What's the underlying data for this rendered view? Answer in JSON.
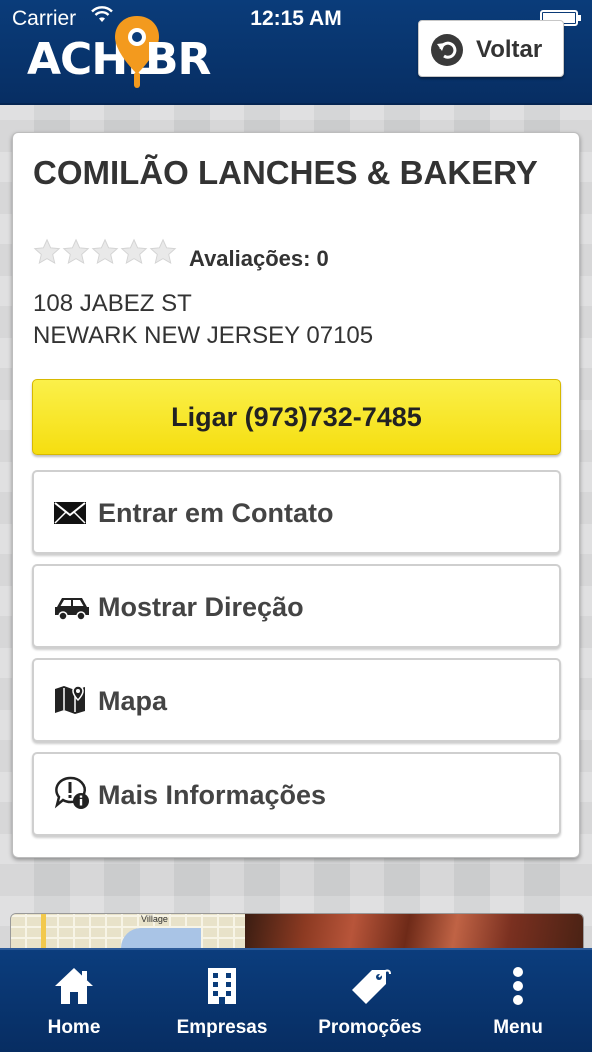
{
  "status_bar": {
    "carrier": "Carrier",
    "time": "12:15 AM"
  },
  "header": {
    "logo_left": "ACHE",
    "logo_right": "BR",
    "back_label": "Voltar"
  },
  "business": {
    "name": "COMILÃO LANCHES & BAKERY",
    "rating_stars": 0,
    "max_stars": 5,
    "reviews_label": "Avaliações:",
    "reviews_count": "0",
    "address_line1": "108 JABEZ ST",
    "address_line2": "NEWARK NEW JERSEY 07105"
  },
  "actions": {
    "call_label": "Ligar (973)732-7485",
    "contact_label": "Entrar em Contato",
    "directions_label": "Mostrar Direção",
    "map_label": "Mapa",
    "info_label": "Mais Informações"
  },
  "photos": {
    "map_text": "Village"
  },
  "tabbar": {
    "home": "Home",
    "companies": "Empresas",
    "promotions": "Promoções",
    "menu": "Menu"
  },
  "colors": {
    "header_blue": "#0a3c7a",
    "logo_orange": "#f39a1e",
    "call_yellow": "#f5de10"
  },
  "icons": {
    "logo_pin": "location-pin-icon",
    "back": "undo-arrow-icon",
    "contact": "envelope-icon",
    "directions": "car-icon",
    "map": "map-icon",
    "info": "info-bubble-icon",
    "home": "home-icon",
    "companies": "building-icon",
    "promotions": "tag-icon",
    "menu": "vertical-dots-icon"
  }
}
